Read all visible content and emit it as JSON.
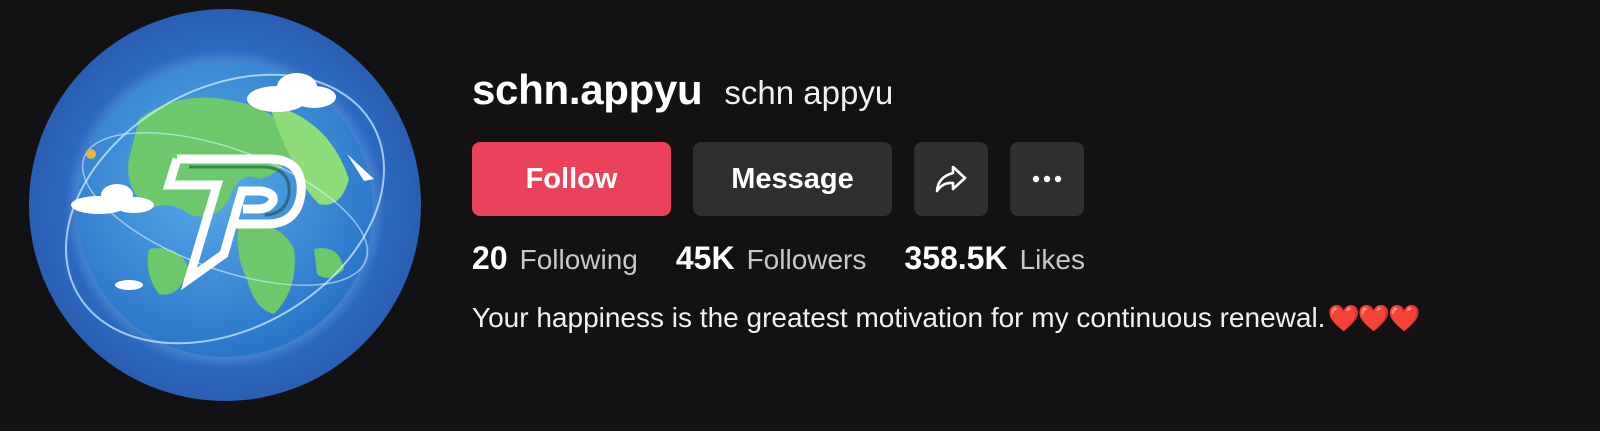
{
  "profile": {
    "username": "schn.appyu",
    "nickname": "schn appyu",
    "avatar": {
      "icon": "globe-p-logo",
      "letter": "P"
    }
  },
  "actions": {
    "follow_label": "Follow",
    "message_label": "Message",
    "share_icon": "share-arrow-icon",
    "more_icon": "more-horizontal-icon"
  },
  "stats": [
    {
      "value": "20",
      "label": "Following"
    },
    {
      "value": "45K",
      "label": "Followers"
    },
    {
      "value": "358.5K",
      "label": "Likes"
    }
  ],
  "bio": {
    "text": "Your happiness is the greatest motivation for my continuous renewal.",
    "emoji": "❤️❤️❤️"
  },
  "colors": {
    "background": "#121212",
    "follow": "#e9425a",
    "secondary_button": "#2f2f2f",
    "text": "#f1f1f2",
    "muted": "#c8c8ca"
  }
}
